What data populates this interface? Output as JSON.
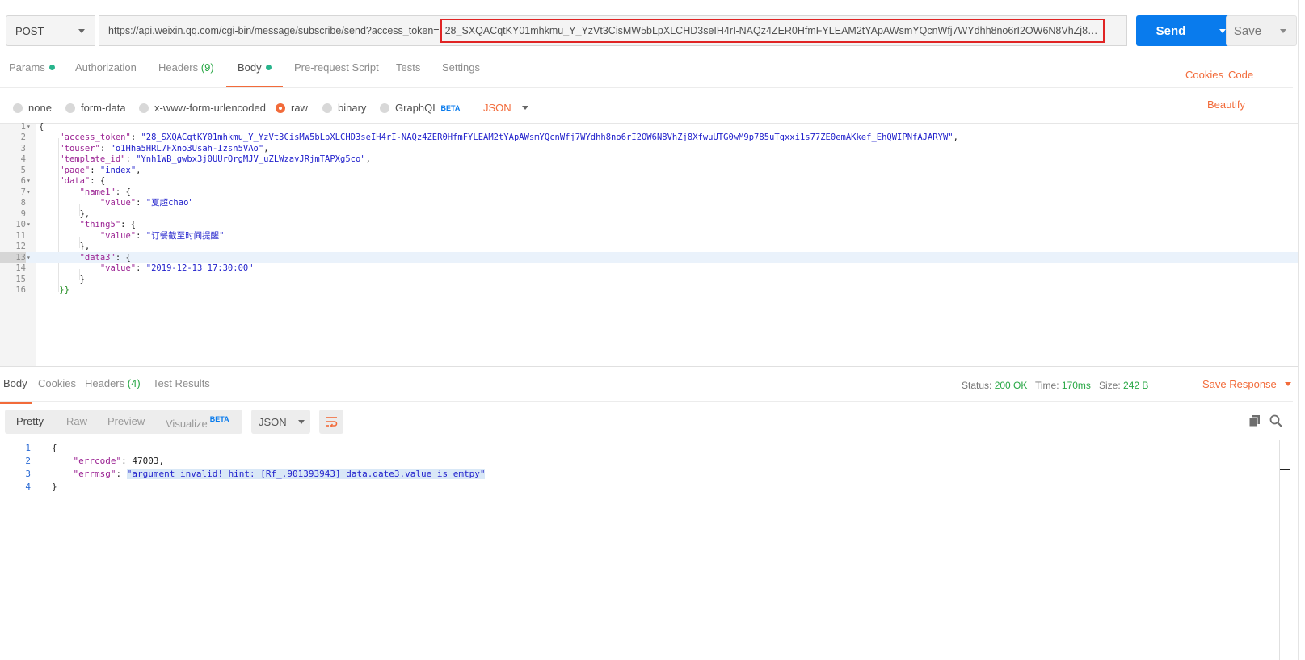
{
  "request": {
    "method": "POST",
    "url_base": "https://api.weixin.qq.com/cgi-bin/message/subscribe/send?access_token=",
    "url_token": "28_SXQACqtKY01mhkmu_Y_YzVt3CisMW5bLpXLCHD3seIH4rI-NAQz4ZER0HfmFYLEAM2tYApAWsmYQcnWfj7WYdhh8no6rI2OW6N8VhZj8XfwuUTG0w...",
    "send_label": "Send",
    "save_label": "Save"
  },
  "request_tabs": {
    "params": "Params",
    "authorization": "Authorization",
    "headers": "Headers",
    "headers_count": "(9)",
    "body": "Body",
    "pre_request": "Pre-request Script",
    "tests": "Tests",
    "settings": "Settings",
    "cookies": "Cookies",
    "code": "Code"
  },
  "body_modes": {
    "none": "none",
    "form_data": "form-data",
    "urlencoded": "x-www-form-urlencoded",
    "raw": "raw",
    "binary": "binary",
    "graphql": "GraphQL",
    "beta": "BETA",
    "format": "JSON",
    "beautify": "Beautify"
  },
  "request_body": {
    "l1": "{",
    "l2_key": "\"access_token\"",
    "l2_val": "\"28_SXQACqtKY01mhkmu_Y_YzVt3CisMW5bLpXLCHD3seIH4rI-NAQz4ZER0HfmFYLEAM2tYApAWsmYQcnWfj7WYdhh8no6rI2OW6N8VhZj8XfwuUTG0wM9p785uTqxxi1s77ZE0emAKkef_EhQWIPNfAJARYW\"",
    "l3_key": "\"touser\"",
    "l3_val": "\"o1Hha5HRL7FXno3Usah-Izsn5VAo\"",
    "l4_key": "\"template_id\"",
    "l4_val": "\"Ynh1WB_gwbx3j0UUrQrgMJV_uZLWzavJRjmTAPXg5co\"",
    "l5_key": "\"page\"",
    "l5_val": "\"index\"",
    "l6_key": "\"data\"",
    "l7_key": "\"name1\"",
    "l8_key": "\"value\"",
    "l8_val": "\"夏超chao\"",
    "l10_key": "\"thing5\"",
    "l11_key": "\"value\"",
    "l11_val": "\"订餐截至时间提醒\"",
    "l13_key": "\"data3\"",
    "l14_key": "\"value\"",
    "l14_val": "\"2019-12-13 17:30:00\"",
    "l16": "}}"
  },
  "response_tabs": {
    "body": "Body",
    "cookies": "Cookies",
    "headers": "Headers",
    "headers_count": "(4)",
    "test_results": "Test Results"
  },
  "response_status": {
    "status_label": "Status:",
    "status_value": "200 OK",
    "time_label": "Time:",
    "time_value": "170ms",
    "size_label": "Size:",
    "size_value": "242 B",
    "save_response": "Save Response"
  },
  "response_view": {
    "pretty": "Pretty",
    "raw": "Raw",
    "preview": "Preview",
    "visualize": "Visualize",
    "beta": "BETA",
    "format": "JSON"
  },
  "response_body": {
    "l1": "{",
    "errcode_key": "\"errcode\"",
    "errcode_val": "47003",
    "errmsg_key": "\"errmsg\"",
    "errmsg_val": "\"argument invalid! hint: [Rf_.901393943] data.date3.value is emtpy\"",
    "l4": "}"
  },
  "colors": {
    "accent": "#f26b3a",
    "send_blue": "#097bed",
    "success_green": "#28a745",
    "highlight_red": "#e02424"
  }
}
